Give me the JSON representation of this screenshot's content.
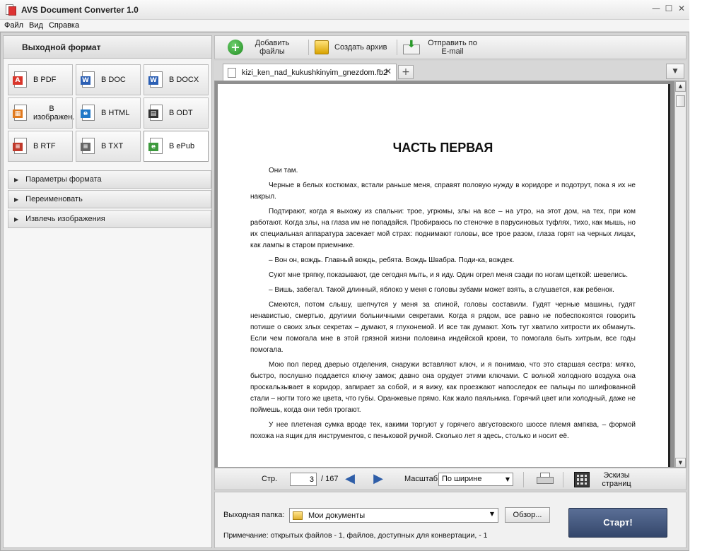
{
  "window": {
    "title": "AVS Document Converter 1.0",
    "controls": [
      "—",
      "☐",
      "✕"
    ]
  },
  "menu": [
    "Файл",
    "Вид",
    "Справка"
  ],
  "left_panel": {
    "header": "Выходной формат",
    "formats": [
      {
        "label": "В PDF",
        "icon": "pdf-icon",
        "color": "#d9362b",
        "mark": "A",
        "active": false
      },
      {
        "label": "В DOC",
        "icon": "doc-icon",
        "color": "#2b5fb4",
        "mark": "W",
        "active": false
      },
      {
        "label": "В DOCX",
        "icon": "docx-icon",
        "color": "#2b5fb4",
        "mark": "W",
        "active": false
      },
      {
        "label": "В изображен.",
        "icon": "image-icon",
        "color": "#e07a1f",
        "mark": "▦",
        "active": false
      },
      {
        "label": "В HTML",
        "icon": "html-icon",
        "color": "#1f78c8",
        "mark": "e",
        "active": false
      },
      {
        "label": "В ODT",
        "icon": "odt-icon",
        "color": "#333333",
        "mark": "▤",
        "active": false
      },
      {
        "label": "В RTF",
        "icon": "rtf-icon",
        "color": "#c0392b",
        "mark": "≡",
        "active": false
      },
      {
        "label": "В TXT",
        "icon": "txt-icon",
        "color": "#666666",
        "mark": "≡",
        "active": false
      },
      {
        "label": "В ePub",
        "icon": "epub-icon",
        "color": "#3d9a3d",
        "mark": "e",
        "active": true
      }
    ],
    "sections": [
      "Параметры формата",
      "Переименовать",
      "Извлечь изображения"
    ]
  },
  "toolbar": {
    "add_files": "Добавить файлы",
    "create_archive": "Создать архив",
    "send_email": "Отправить по E-mail"
  },
  "tabs": {
    "file_name": "kizi_ken_nad_kukushkinyim_gnezdom.fb2",
    "close": "✕",
    "add": "+",
    "dropdown": "▼"
  },
  "document": {
    "chapter_title": "ЧАСТЬ ПЕРВАЯ",
    "paragraphs": [
      "Они там.",
      "Черные в белых костюмах, встали раньше меня, справят половую нужду в коридоре и подотрут, пока я их не накрыл.",
      "Подтирают, когда я выхожу из спальни: трое, угрюмы, злы на все – на утро, на этот дом, на тех, при ком работают. Когда злы, на глаза им не попадайся. Пробираюсь по стеночке в парусиновых туфлях, тихо, как мышь, но их специальная аппаратура засекает мой страх: поднимают головы, все трое разом, глаза горят на черных лицах, как лампы в старом приемнике.",
      "– Вон он, вождь. Главный вождь, ребята. Вождь Швабра. Поди-ка, вождек.",
      "Суют мне тряпку, показывают, где сегодня мыть, и я иду. Один огрел меня сзади по ногам щеткой: шевелись.",
      "– Вишь, забегал. Такой длинный, яблоко у меня с головы зубами может взять, а слушается, как ребенок.",
      "Смеются, потом слышу, шепчутся у меня за спиной, головы составили. Гудят черные машины, гудят ненавистью, смертью, другими больничными секретами. Когда я рядом, все равно не побеспокоятся говорить потише о своих злых секретах – думают, я глухонемой. И все так думают. Хоть тут хватило хитрости их обмануть. Если чем помогала мне в этой грязной жизни половина индейской крови, то помогала быть хитрым, все годы помогала.",
      "Мою пол перед дверью отделения, снаружи вставляют ключ, и я понимаю, что это старшая сестра: мягко, быстро, послушно поддается ключу замок; давно она орудует этими ключами. С волной холодного воздуха она проскальзывает в коридор, запирает за собой, и я вижу, как проезжают напоследок ее пальцы по шлифованной стали – ногти того же цвета, что губы. Оранжевые прямо. Как жало паяльника. Горячий цвет или холодный, даже не поймешь, когда они тебя трогают.",
      "У нее плетеная сумка вроде тех, какими торгуют у горячего августовского шоссе племя ампква, – формой похожа на ящик для инструментов, с пеньковой ручкой. Сколько лет я здесь, столько и носит её."
    ]
  },
  "navigation": {
    "page_label": "Стр.",
    "current_page": "3",
    "total_pages": "/ 167",
    "prev": "◀",
    "next": "▶",
    "zoom_label": "Масштаб",
    "zoom_value": "По ширине",
    "thumbnails": "Эскизы страниц"
  },
  "output": {
    "folder_label": "Выходная папка:",
    "folder_value": "Мои документы",
    "browse": "Обзор...",
    "note": "Примечание: открытых файлов - 1, файлов, доступных для конвертации, - 1",
    "start": "Старт!"
  }
}
